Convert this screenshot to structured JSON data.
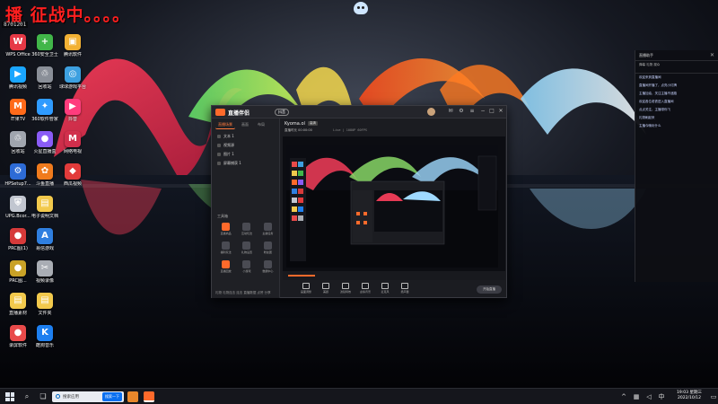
{
  "overlay": {
    "title": "播 征战中。。。。",
    "id": "8701201"
  },
  "desktop_icons": [
    {
      "label": "WPS Office",
      "color": "#e63946",
      "glyph": "W"
    },
    {
      "label": "360安全卫士",
      "color": "#41b649",
      "glyph": "+"
    },
    {
      "label": "腾讯软件",
      "color": "#f2b134",
      "glyph": "▣"
    },
    {
      "label": "腾讯视频",
      "color": "#1aa6ff",
      "glyph": "▶"
    },
    {
      "label": "回收站",
      "color": "#8a8f98",
      "glyph": "♲"
    },
    {
      "label": "球球游戏平台",
      "color": "#3da0e0",
      "glyph": "◎"
    },
    {
      "label": "芒果TV",
      "color": "#ff6a1a",
      "glyph": "M"
    },
    {
      "label": "360软件管家",
      "color": "#2f9bff",
      "glyph": "✦"
    },
    {
      "label": "抖音",
      "color": "#ff3c7d",
      "glyph": "▶"
    },
    {
      "label": "回收站",
      "color": "#a0a5ae",
      "glyph": "♲"
    },
    {
      "label": "火星直播盒",
      "color": "#8a5cf6",
      "glyph": "●"
    },
    {
      "label": "网络电视",
      "color": "#d12f4c",
      "glyph": "M"
    },
    {
      "label": "HPSetup7...",
      "color": "#2d6bd6",
      "glyph": "⚙"
    },
    {
      "label": "斗鱼直播",
      "color": "#f07b1d",
      "glyph": "✿"
    },
    {
      "label": "西瓜视频",
      "color": "#e23b3b",
      "glyph": "◆"
    },
    {
      "label": "UPG.Bcor...",
      "color": "#c1c6d0",
      "glyph": "⛨"
    },
    {
      "label": "电子说明文档",
      "color": "#f2c94c",
      "glyph": "▤"
    },
    {
      "label": "PRC图(1)",
      "color": "#d63a3a",
      "glyph": "●"
    },
    {
      "label": "易信游戏",
      "color": "#2f7fe0",
      "glyph": "A"
    },
    {
      "label": "PRC图...",
      "color": "#c9a227",
      "glyph": "●"
    },
    {
      "label": "视频录像",
      "color": "#a9adb4",
      "glyph": "✂"
    },
    {
      "label": "直播素材",
      "color": "#f2c94c",
      "glyph": "▤"
    },
    {
      "label": "文件夹",
      "color": "#f2c94c",
      "glyph": "▤"
    },
    {
      "label": "录屏软件",
      "color": "#e84a4a",
      "glyph": "●"
    },
    {
      "label": "酷狗音乐",
      "color": "#1d7ff0",
      "glyph": "K"
    }
  ],
  "app": {
    "title": "直播伴侣",
    "badge": "抖音",
    "tabs": [
      "直播场景",
      "画面",
      "布局"
    ],
    "scenes": [
      "文本 1",
      "视频源",
      "图片 1",
      "屏幕捕获 1"
    ],
    "tools_title": "工具箱",
    "tools": [
      "直播商品",
      "互动玩法",
      "主播任务",
      "福利玩法",
      "礼物设置",
      "粉丝团",
      "直播回放",
      "小游戏",
      "数据中心"
    ],
    "footer_text": "礼物 礼物连击 连击 直播数据 点赞 分享",
    "account_name": "Kyoma.ol",
    "account_tag": "高清",
    "account_sub": "直播时长 00:00:00",
    "stream_info": "Live | 1080P 60FPS",
    "toolbar": [
      "画面调整",
      "美颜",
      "滤镜特效",
      "虚拟背景",
      "麦克风",
      "扬声器"
    ],
    "live_button": "开始直播"
  },
  "chat": {
    "header": "直播助手",
    "sub_header": "弹幕 礼物 观众",
    "messages": [
      "欢迎来到直播间",
      "直播间开播了，点亮小灯牌",
      "主播加油，关注主播不迷路",
      "欢迎各位老铁进入直播间",
      "点点关注，主播带你飞",
      "礼物刷起来",
      "主播今晚玩什么"
    ]
  },
  "taskbar": {
    "search_placeholder": "搜索应用",
    "search_button": "搜索一下",
    "clock_time": "19:03 星期三",
    "clock_date": "2022/10/12"
  },
  "colors": {
    "accent": "#ff6a2b",
    "taskbar": "#15161c",
    "overlay_red": "#ff1f1f"
  }
}
